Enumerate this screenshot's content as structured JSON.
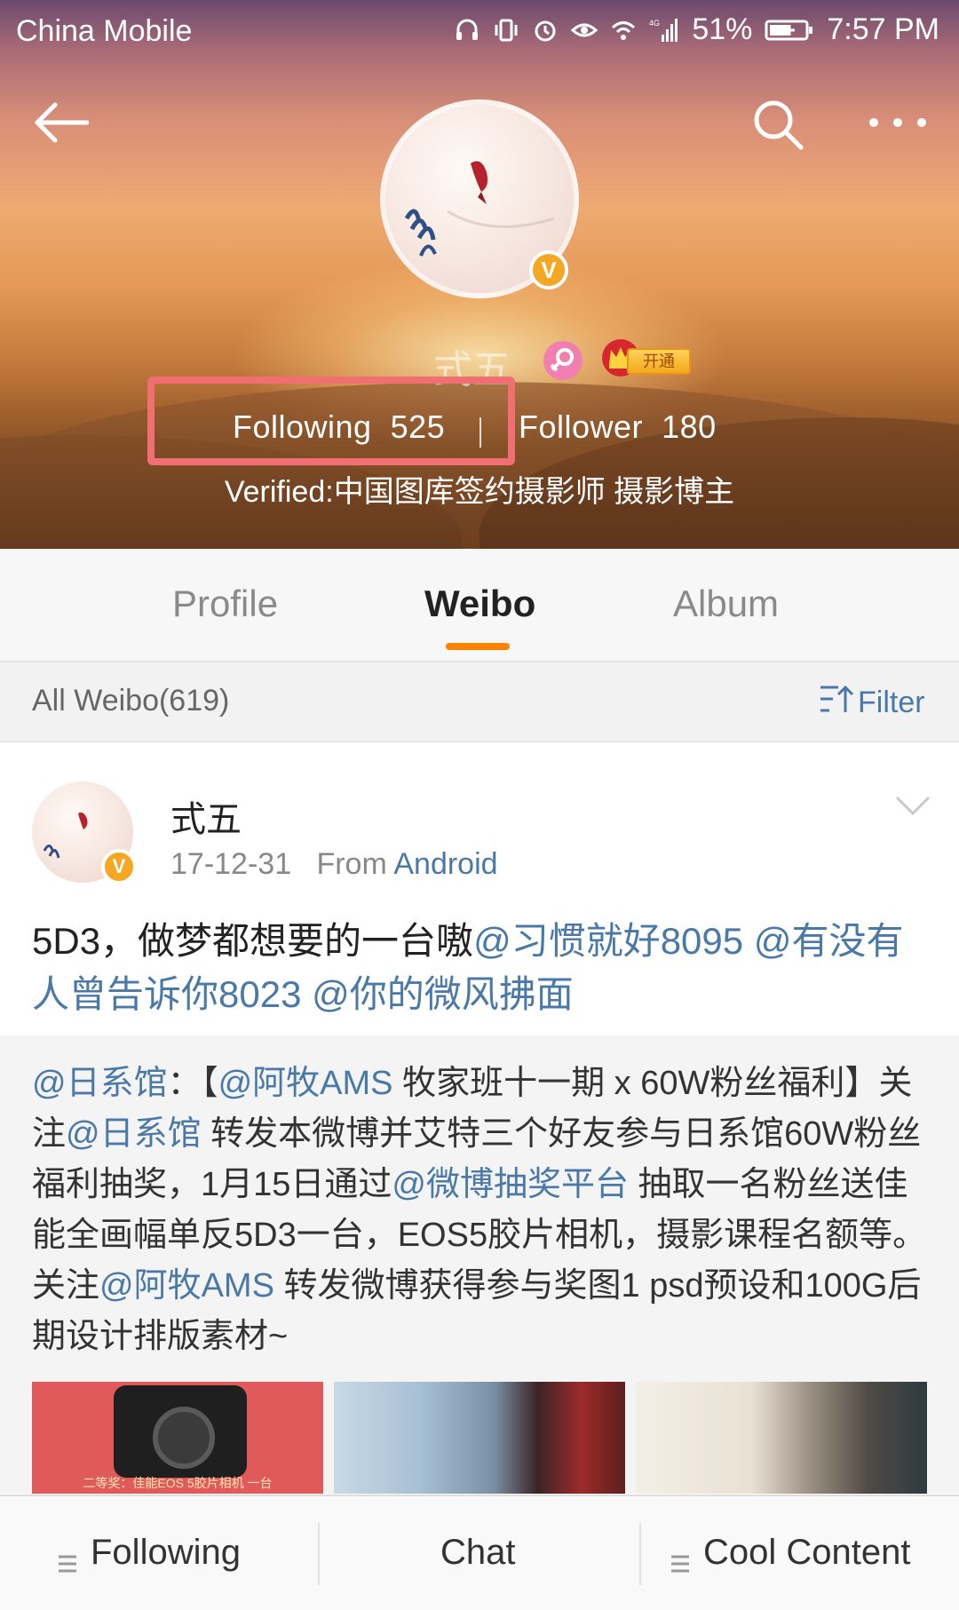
{
  "status_bar": {
    "carrier": "China Mobile",
    "network": "4G",
    "battery": "51%",
    "time": "7:57 PM",
    "icons": [
      "headphones-icon",
      "vibrate-icon",
      "alarm-icon",
      "eye-icon",
      "wifi-icon",
      "signal-icon",
      "battery-charging-icon"
    ]
  },
  "header": {
    "username": "式五",
    "vip_label": "开通",
    "verified_badge": "V",
    "following_label": "Following",
    "following_count": "525",
    "divider": "|",
    "follower_label": "Follower",
    "follower_count": "180",
    "verified_text": "Verified:中国图库签约摄影师 摄影博主"
  },
  "tabs": [
    {
      "label": "Profile",
      "active": false
    },
    {
      "label": "Weibo",
      "active": true
    },
    {
      "label": "Album",
      "active": false
    }
  ],
  "filter_bar": {
    "count_label": "All Weibo(619)",
    "filter_label": "Filter"
  },
  "post": {
    "author": "式五",
    "date": "17-12-31",
    "from_label": "From",
    "source": "Android",
    "text_plain": "5D3，做梦都想要的一台嗷",
    "mentions": [
      "@习惯就好8095",
      "@有没有人曾告诉你8023",
      "@你的微风拂面"
    ]
  },
  "repost": {
    "author_mention": "@日系馆",
    "segments": [
      {
        "text": "@日系馆",
        "mention": true
      },
      {
        "text": "：【",
        "mention": false
      },
      {
        "text": "@阿牧AMS",
        "mention": true
      },
      {
        "text": " 牧家班十一期 x 60W粉丝福利】关注",
        "mention": false
      },
      {
        "text": "@日系馆",
        "mention": true
      },
      {
        "text": " 转发本微博并艾特三个好友参与日系馆60W粉丝福利抽奖，1月15日通过",
        "mention": false
      },
      {
        "text": "@微博抽奖平台",
        "mention": true
      },
      {
        "text": " 抽取一名粉丝送佳能全画幅单反5D3一台，EOS5胶片相机，摄影课程名额等。关注",
        "mention": false
      },
      {
        "text": "@阿牧AMS",
        "mention": true
      },
      {
        "text": " 转发微博获得参与奖图1 psd预设和100G后期设计排版素材~",
        "mention": false
      }
    ],
    "thumb_caption": "二等奖：佳能EOS 5胶片相机 一台"
  },
  "bottom_bar": {
    "following": "Following",
    "chat": "Chat",
    "cool_content": "Cool Content"
  },
  "colors": {
    "accent_orange": "#ff8200",
    "link_blue": "#4a79a8",
    "verified_gold": "#f5a623",
    "highlight_box": "#ef6f73"
  }
}
